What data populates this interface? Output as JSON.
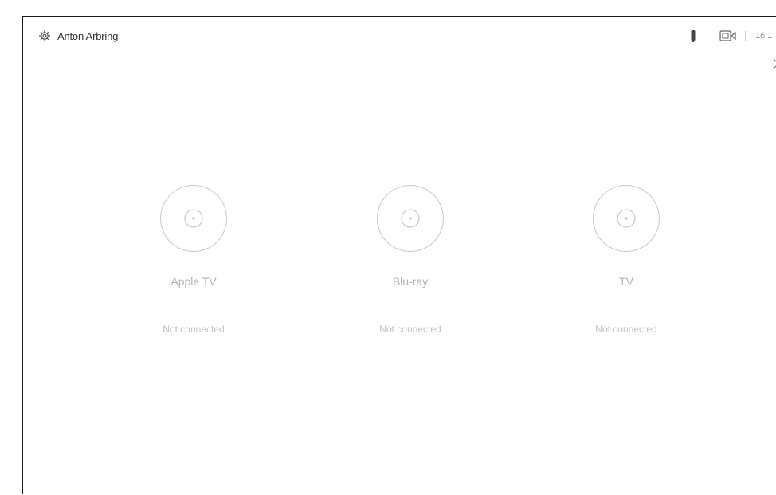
{
  "header": {
    "user_name": "Anton Arbring",
    "settings_icon": "gear-icon",
    "mic_icon": "microphone-icon",
    "camera_icon": "camera-icon",
    "time": "16:1",
    "close_icon": "close-icon"
  },
  "sources": [
    {
      "label": "Apple TV",
      "status": "Not connected",
      "icon": "source-icon"
    },
    {
      "label": "Blu-ray",
      "status": "Not connected",
      "icon": "source-icon"
    },
    {
      "label": "TV",
      "status": "Not connected",
      "icon": "source-icon"
    }
  ],
  "colors": {
    "text_primary": "#333333",
    "text_muted": "#b3b3b3",
    "circle_border": "#c9c9c9",
    "frame_border": "#1a1a1a"
  }
}
